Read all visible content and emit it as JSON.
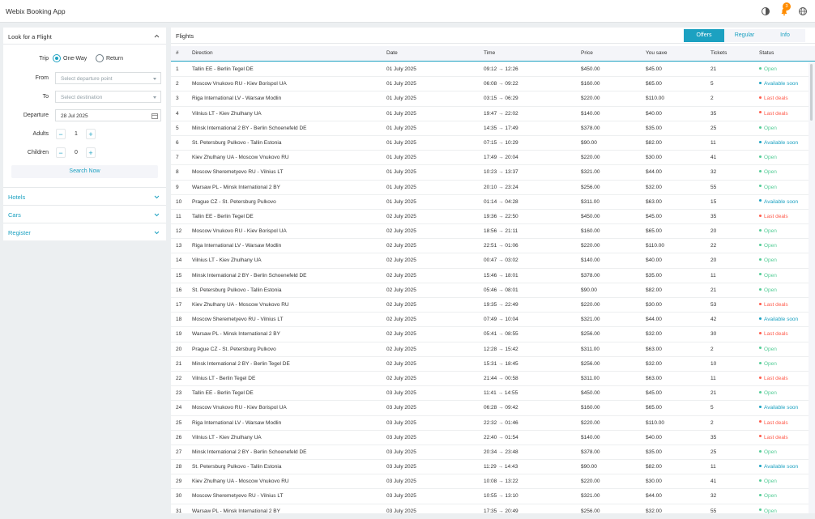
{
  "app": {
    "title": "Webix Booking App",
    "notif_count": "3"
  },
  "colors": {
    "accent": "#1ca1c1",
    "open": "#55cd97",
    "last": "#ff5c4c",
    "orange": "#ff8c00"
  },
  "left": {
    "flight_panel_title": "Look for a Flight",
    "trip_label": "Trip",
    "trip_options": [
      "One-Way",
      "Return"
    ],
    "trip_selected": "One-Way",
    "from_label": "From",
    "from_placeholder": "Select departure point",
    "to_label": "To",
    "to_placeholder": "Select destination",
    "departure_label": "Departure",
    "departure_value": "28 Jul 2025",
    "adults_label": "Adults",
    "adults_value": "1",
    "children_label": "Children",
    "children_value": "0",
    "search_label": "Search Now",
    "accordion": [
      "Hotels",
      "Cars",
      "Register"
    ]
  },
  "right": {
    "title": "Flights",
    "tabs": [
      "Offers",
      "Regular",
      "Info"
    ],
    "active_tab": "Offers",
    "columns": [
      "#",
      "Direction",
      "Date",
      "Time",
      "Price",
      "You save",
      "Tickets",
      "Status"
    ],
    "rows": [
      [
        "1",
        "Tallin EE - Berlin Tegel DE",
        "01 July 2025",
        "09:12",
        "12:26",
        "$450.00",
        "$45.00",
        "21",
        "Open"
      ],
      [
        "2",
        "Moscow Vnukovo RU - Kiev Borispol UA",
        "01 July 2025",
        "06:08",
        "09:22",
        "$160.00",
        "$65.00",
        "5",
        "Available soon"
      ],
      [
        "3",
        "Riga International LV - Warsaw Modlin",
        "01 July 2025",
        "03:15",
        "06:29",
        "$220.00",
        "$110.00",
        "2",
        "Last deals"
      ],
      [
        "4",
        "Vilnius LT - Kiev Zhulhany UA",
        "01 July 2025",
        "19:47",
        "22:02",
        "$140.00",
        "$40.00",
        "35",
        "Last deals"
      ],
      [
        "5",
        "Minsk International 2 BY - Berlin Schoenefeld DE",
        "01 July 2025",
        "14:35",
        "17:49",
        "$378.00",
        "$35.00",
        "25",
        "Open"
      ],
      [
        "6",
        "St. Petersburg Pulkovo - Tallin Estonia",
        "01 July 2025",
        "07:15",
        "10:29",
        "$90.00",
        "$82.00",
        "11",
        "Available soon"
      ],
      [
        "7",
        "Kiev Zhulhany UA - Moscow Vnukovo RU",
        "01 July 2025",
        "17:49",
        "20:04",
        "$220.00",
        "$30.00",
        "41",
        "Open"
      ],
      [
        "8",
        "Moscow Sheremetyevo RU - Vilnius LT",
        "01 July 2025",
        "10:23",
        "13:37",
        "$321.00",
        "$44.00",
        "32",
        "Open"
      ],
      [
        "9",
        "Warsaw PL - Minsk International 2 BY",
        "01 July 2025",
        "20:10",
        "23:24",
        "$256.00",
        "$32.00",
        "55",
        "Open"
      ],
      [
        "10",
        "Prague CZ - St. Petersburg Pulkovo",
        "01 July 2025",
        "01:14",
        "04:28",
        "$311.00",
        "$63.00",
        "15",
        "Available soon"
      ],
      [
        "11",
        "Tallin EE - Berlin Tegel DE",
        "02 July 2025",
        "19:36",
        "22:50",
        "$450.00",
        "$45.00",
        "35",
        "Last deals"
      ],
      [
        "12",
        "Moscow Vnukovo RU - Kiev Borispol UA",
        "02 July 2025",
        "18:56",
        "21:11",
        "$160.00",
        "$65.00",
        "20",
        "Open"
      ],
      [
        "13",
        "Riga International LV - Warsaw Modlin",
        "02 July 2025",
        "22:51",
        "01:06",
        "$220.00",
        "$110.00",
        "22",
        "Open"
      ],
      [
        "14",
        "Vilnius LT - Kiev Zhulhany UA",
        "02 July 2025",
        "00:47",
        "03:02",
        "$140.00",
        "$40.00",
        "20",
        "Open"
      ],
      [
        "15",
        "Minsk International 2 BY - Berlin Schoenefeld DE",
        "02 July 2025",
        "15:46",
        "18:01",
        "$378.00",
        "$35.00",
        "11",
        "Open"
      ],
      [
        "16",
        "St. Petersburg Pulkovo - Tallin Estonia",
        "02 July 2025",
        "05:46",
        "08:01",
        "$90.00",
        "$82.00",
        "21",
        "Open"
      ],
      [
        "17",
        "Kiev Zhulhany UA - Moscow Vnukovo RU",
        "02 July 2025",
        "19:35",
        "22:49",
        "$220.00",
        "$30.00",
        "53",
        "Last deals"
      ],
      [
        "18",
        "Moscow Sheremetyevo RU - Vilnius LT",
        "02 July 2025",
        "07:49",
        "10:04",
        "$321.00",
        "$44.00",
        "42",
        "Available soon"
      ],
      [
        "19",
        "Warsaw PL - Minsk International 2 BY",
        "02 July 2025",
        "05:41",
        "08:55",
        "$256.00",
        "$32.00",
        "30",
        "Last deals"
      ],
      [
        "20",
        "Prague CZ - St. Petersburg Pulkovo",
        "02 July 2025",
        "12:28",
        "15:42",
        "$311.00",
        "$63.00",
        "2",
        "Open"
      ],
      [
        "21",
        "Minsk International 2 BY - Berlin Tegel DE",
        "02 July 2025",
        "15:31",
        "18:45",
        "$256.00",
        "$32.00",
        "10",
        "Open"
      ],
      [
        "22",
        "Vilnius LT - Berlin Tegel DE",
        "02 July 2025",
        "21:44",
        "00:58",
        "$311.00",
        "$63.00",
        "11",
        "Last deals"
      ],
      [
        "23",
        "Tallin EE - Berlin Tegel DE",
        "03 July 2025",
        "11:41",
        "14:55",
        "$450.00",
        "$45.00",
        "21",
        "Open"
      ],
      [
        "24",
        "Moscow Vnukovo RU - Kiev Borispol UA",
        "03 July 2025",
        "06:28",
        "09:42",
        "$160.00",
        "$65.00",
        "5",
        "Available soon"
      ],
      [
        "25",
        "Riga International LV - Warsaw Modlin",
        "03 July 2025",
        "22:32",
        "01:46",
        "$220.00",
        "$110.00",
        "2",
        "Last deals"
      ],
      [
        "26",
        "Vilnius LT - Kiev Zhulhany UA",
        "03 July 2025",
        "22:40",
        "01:54",
        "$140.00",
        "$40.00",
        "35",
        "Last deals"
      ],
      [
        "27",
        "Minsk International 2 BY - Berlin Schoenefeld DE",
        "03 July 2025",
        "20:34",
        "23:48",
        "$378.00",
        "$35.00",
        "25",
        "Open"
      ],
      [
        "28",
        "St. Petersburg Pulkovo - Tallin Estonia",
        "03 July 2025",
        "11:29",
        "14:43",
        "$90.00",
        "$82.00",
        "11",
        "Available soon"
      ],
      [
        "29",
        "Kiev Zhulhany UA - Moscow Vnukovo RU",
        "03 July 2025",
        "10:08",
        "13:22",
        "$220.00",
        "$30.00",
        "41",
        "Open"
      ],
      [
        "30",
        "Moscow Sheremetyevo RU - Vilnius LT",
        "03 July 2025",
        "10:55",
        "13:10",
        "$321.00",
        "$44.00",
        "32",
        "Open"
      ],
      [
        "31",
        "Warsaw PL - Minsk International 2 BY",
        "03 July 2025",
        "17:35",
        "20:49",
        "$256.00",
        "$32.00",
        "55",
        "Open"
      ]
    ]
  }
}
